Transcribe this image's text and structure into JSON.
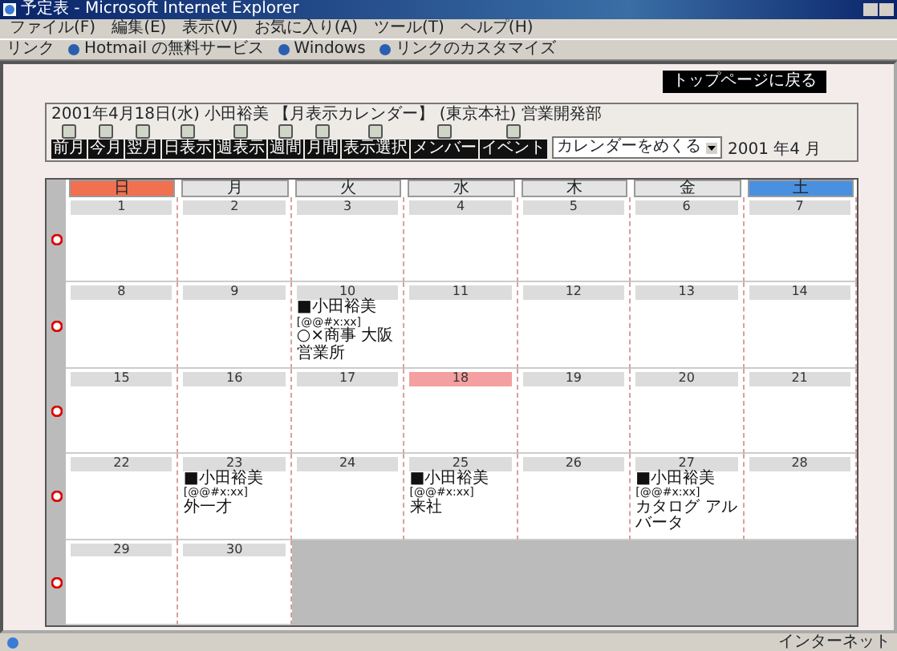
{
  "window": {
    "title": "予定表 - Microsoft Internet Explorer"
  },
  "menu": [
    "ファイル(F)",
    "編集(E)",
    "表示(V)",
    "お気に入り(A)",
    "ツール(T)",
    "ヘルプ(H)"
  ],
  "links_bar": {
    "label": "リンク",
    "links": [
      "Hotmail の無料サービス",
      "Windows",
      "リンクのカスタマイズ"
    ]
  },
  "top_button": "トップページに戻る",
  "header": {
    "title": "2001年4月18日(水) 小田裕美 【月表示カレンダー】 (東京本社) 営業開発部",
    "buttons": [
      "前月",
      "今月",
      "翌月",
      "日表示",
      "週表示",
      "週間",
      "月間",
      "表示選択",
      "メンバー",
      "イベント"
    ],
    "select": "カレンダーをめくる",
    "month": "2001 年4 月"
  },
  "calendar": {
    "weekdays": [
      {
        "label": "日",
        "kind": "sunday"
      },
      {
        "label": "月",
        "kind": "weekday"
      },
      {
        "label": "火",
        "kind": "weekday"
      },
      {
        "label": "水",
        "kind": "weekday"
      },
      {
        "label": "木",
        "kind": "weekday"
      },
      {
        "label": "金",
        "kind": "weekday"
      },
      {
        "label": "土",
        "kind": "saturday"
      }
    ],
    "weeks": [
      {
        "days": [
          {
            "date": "1",
            "today": false
          },
          {
            "date": "2",
            "today": false
          },
          {
            "date": "3",
            "today": false
          },
          {
            "date": "4",
            "today": false
          },
          {
            "date": "5",
            "today": false
          },
          {
            "date": "6",
            "today": false
          },
          {
            "date": "7",
            "today": false
          }
        ]
      },
      {
        "days": [
          {
            "date": "8",
            "today": false
          },
          {
            "date": "9",
            "today": false
          },
          {
            "date": "10",
            "today": false,
            "events": [
              {
                "title": "■小田裕美",
                "time": "[@@#x:xx]",
                "note": "○×商事 大阪営業所"
              }
            ]
          },
          {
            "date": "11",
            "today": false
          },
          {
            "date": "12",
            "today": false
          },
          {
            "date": "13",
            "today": false
          },
          {
            "date": "14",
            "today": false
          }
        ]
      },
      {
        "days": [
          {
            "date": "15",
            "today": false
          },
          {
            "date": "16",
            "today": false
          },
          {
            "date": "17",
            "today": false
          },
          {
            "date": "18",
            "today": true
          },
          {
            "date": "19",
            "today": false
          },
          {
            "date": "20",
            "today": false
          },
          {
            "date": "21",
            "today": false
          }
        ]
      },
      {
        "days": [
          {
            "date": "22",
            "today": false
          },
          {
            "date": "23",
            "today": false,
            "events": [
              {
                "title": "■小田裕美",
                "time": "[@@#x:xx]",
                "note": "外一才"
              }
            ]
          },
          {
            "date": "24",
            "today": false
          },
          {
            "date": "25",
            "today": false,
            "events": [
              {
                "title": "■小田裕美",
                "time": "[@@#x:xx]",
                "note": "来社"
              }
            ]
          },
          {
            "date": "26",
            "today": false
          },
          {
            "date": "27",
            "today": false,
            "events": [
              {
                "title": "■小田裕美",
                "time": "[@@#x:xx]",
                "note": "カタログ アルバータ"
              }
            ]
          },
          {
            "date": "28",
            "today": false
          }
        ]
      },
      {
        "days": [
          {
            "date": "29",
            "today": false
          },
          {
            "date": "30",
            "today": false
          }
        ]
      }
    ]
  },
  "status_bar": {
    "zone": "インターネット"
  }
}
